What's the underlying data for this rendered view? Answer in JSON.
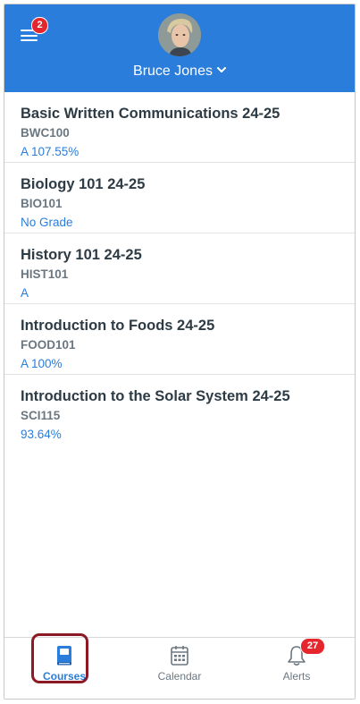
{
  "header": {
    "menu_badge": "2",
    "user_name": "Bruce Jones",
    "accent_color": "#2b7ddb"
  },
  "courses": [
    {
      "title": "Basic Written Communications 24-25",
      "code": "BWC100",
      "grade": "A  107.55%"
    },
    {
      "title": "Biology 101 24-25",
      "code": "BIO101",
      "grade": "No Grade"
    },
    {
      "title": "History 101 24-25",
      "code": "HIST101",
      "grade": "A"
    },
    {
      "title": "Introduction to Foods 24-25",
      "code": "FOOD101",
      "grade": "A  100%"
    },
    {
      "title": "Introduction to the Solar System  24-25",
      "code": "SCI115",
      "grade": "93.64%"
    }
  ],
  "tabbar": {
    "courses_label": "Courses",
    "calendar_label": "Calendar",
    "alerts_label": "Alerts",
    "alerts_badge": "27",
    "active_tab": "Courses"
  },
  "icons": {
    "menu": "hamburger-menu-icon",
    "chevron": "chevron-down-icon",
    "courses": "book-icon",
    "calendar": "calendar-icon",
    "alerts": "bell-icon"
  }
}
